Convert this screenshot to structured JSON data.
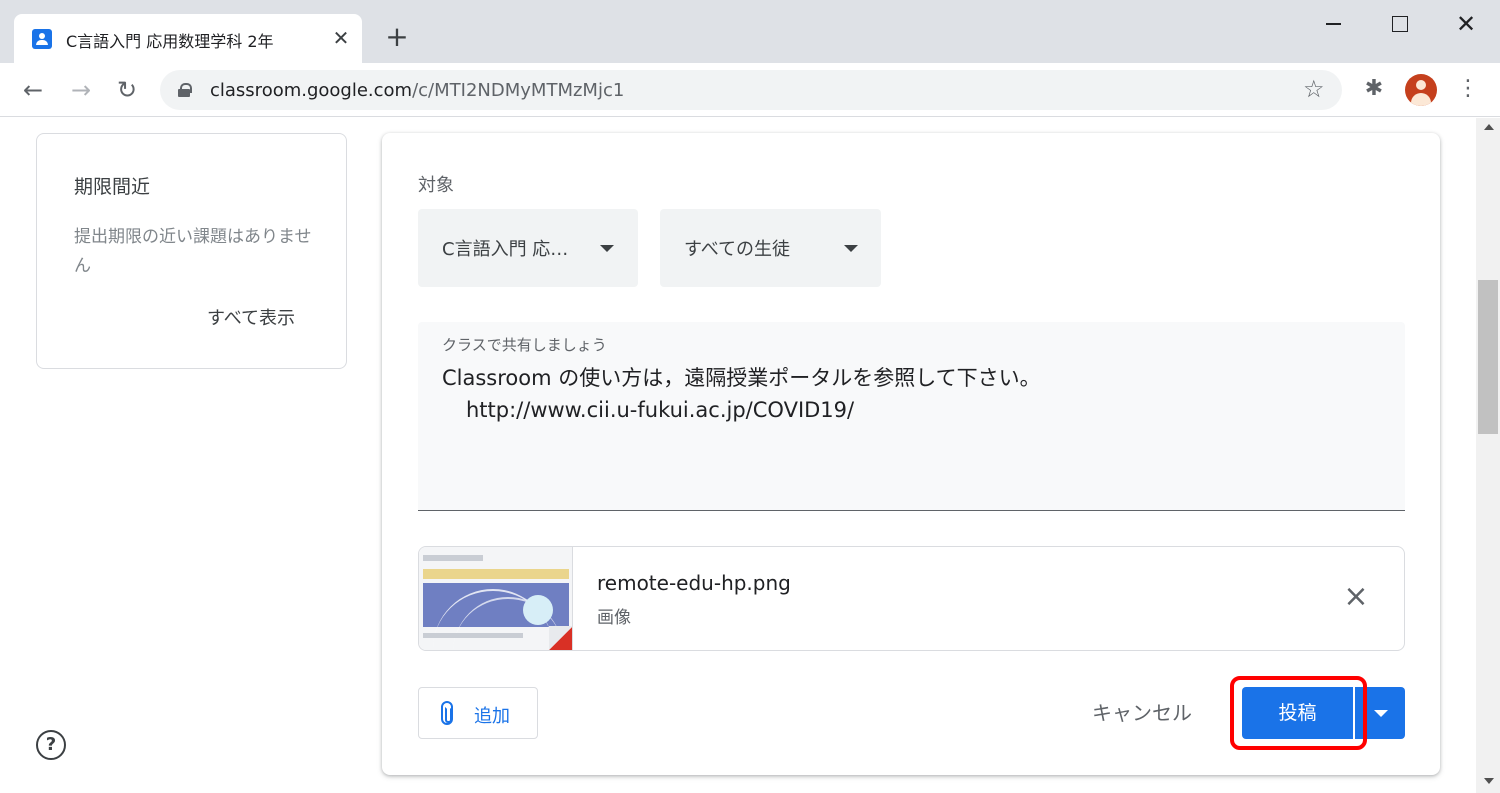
{
  "browser": {
    "tab_title": "C言語入門 応用数理学科 2年",
    "tab_close": "✕",
    "new_tab": "+",
    "url_host": "classroom.google.com",
    "url_path": "/c/MTI2NDMyMTMzMjc1",
    "window_close": "✕"
  },
  "due_card": {
    "title": "期限間近",
    "description": "提出期限の近い課題はありません",
    "view_all": "すべて表示"
  },
  "post_form": {
    "for_label": "対象",
    "class_select": "C言語入門 応…",
    "students_select": "すべての生徒",
    "textarea_label": "クラスで共有しましょう",
    "text_line1": "Classroom の使い方は，遠隔授業ポータルを参照して下さい。",
    "text_line2": "http://www.cii.u-fukui.ac.jp/COVID19/",
    "attachment": {
      "name": "remote-edu-hp.png",
      "type": "画像"
    },
    "add_label": "追加",
    "cancel_label": "キャンセル",
    "post_label": "投稿"
  },
  "help_glyph": "?",
  "colors": {
    "accent": "#1a73e8",
    "highlight": "#ff0000",
    "tabstrip": "#dee1e6"
  }
}
